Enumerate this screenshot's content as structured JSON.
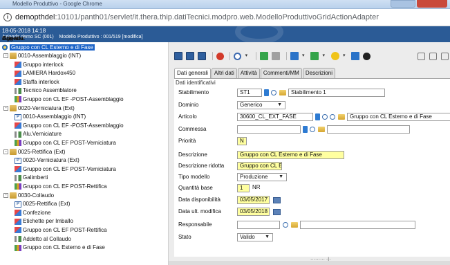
{
  "browser": {
    "title": "Modello Produttivo - Google Chrome",
    "url_host": "demopthdel",
    "url_path": ":10101/panth01/servlet/it.thera.thip.datiTecnici.modpro.web.ModelloProduttivoGridActionAdapter",
    "info_icon": "info-icon"
  },
  "header": {
    "timestamp": "18-05-2018  14:18",
    "azienda_label": "Azienda:",
    "azienda_value": "Azienda demo SC (001)",
    "oggetto_label": "Oggetto:",
    "oggetto_value": "Modello Produttivo : 001/519 [modifica]"
  },
  "tree": {
    "root": "Gruppo con CL Esterno e di Fase",
    "nodes": [
      {
        "text": "0010-Assemblaggio (INT)",
        "icon": "folder",
        "toggle": "-"
      },
      {
        "text": "Gruppo interlock",
        "icon": "cube"
      },
      {
        "text": "LAMIERA Hardox450",
        "icon": "cube"
      },
      {
        "text": "Staffa interlock",
        "icon": "cube"
      },
      {
        "text": "Tecnico Assemblatore",
        "icon": "tool"
      },
      {
        "text": "Gruppo con CL EF -POST-Assemblaggio",
        "icon": "link"
      },
      {
        "text": "0020-Verniciatura (Ext)",
        "icon": "folder",
        "toggle": "-"
      },
      {
        "text": "0010-Assemblaggio (INT)",
        "icon": "doc"
      },
      {
        "text": "Gruppo con CL EF -POST-Assemblaggio",
        "icon": "cube"
      },
      {
        "text": "Alu.Verniciature",
        "icon": "tool"
      },
      {
        "text": "Gruppo con CL EF POST-Verniciatura",
        "icon": "link"
      },
      {
        "text": "0025-Rettifica (Ext)",
        "icon": "folder",
        "toggle": "-"
      },
      {
        "text": "0020-Verniciatura (Ext)",
        "icon": "doc"
      },
      {
        "text": "Gruppo con CL EF POST-Verniciatura",
        "icon": "cube"
      },
      {
        "text": "Galimberti",
        "icon": "tool"
      },
      {
        "text": "Gruppo con CL EF POST-Rettifica",
        "icon": "link"
      },
      {
        "text": "0030-Collaudo",
        "icon": "folder",
        "toggle": "-"
      },
      {
        "text": "0025-Rettifica (Ext)",
        "icon": "doc"
      },
      {
        "text": "Confezione",
        "icon": "cube"
      },
      {
        "text": "Etichette per Imballo",
        "icon": "cube"
      },
      {
        "text": "Gruppo con CL EF POST-Rettifica",
        "icon": "cube"
      },
      {
        "text": "Addetto al Collaudo",
        "icon": "tool"
      },
      {
        "text": "Gruppo con CL Esterno e di Fase",
        "icon": "link"
      }
    ]
  },
  "tabs": [
    "Dati generali",
    "Altri dati",
    "Attività",
    "Commenti/MM",
    "Descrizioni"
  ],
  "form": {
    "section": "Dati identificativi",
    "stabilimento_label": "Stabilimento",
    "stabilimento_code": "ST1",
    "stabilimento_desc": "Stabilimento 1",
    "dominio_label": "Dominio",
    "dominio_value": "Generico",
    "articolo_label": "Articolo",
    "articolo_code": "30600_CL_EXT_FASE",
    "articolo_desc": "Gruppo con CL Esterno e di Fase",
    "commessa_label": "Commessa",
    "priorita_label": "Priorità",
    "priorita_value": "N",
    "descrizione_label": "Descrizione",
    "descrizione_value": "Gruppo con CL Esterno e di Fase",
    "descr_ridotta_label": "Descrizione ridotta",
    "descr_ridotta_value": "Gruppo con CL E",
    "tipo_modello_label": "Tipo modello",
    "tipo_modello_value": "Produzione",
    "quantita_label": "Quantità base",
    "quantita_value": "1",
    "quantita_um": "NR",
    "data_disp_label": "Data disponibilità",
    "data_disp_value": "03/05/2017",
    "data_mod_label": "Data ult. modifica",
    "data_mod_value": "03/05/2018",
    "responsabile_label": "Responsabile",
    "stato_label": "Stato",
    "stato_value": "Valido"
  },
  "colors": {
    "header_bg": "#2b5b96",
    "selected_bg": "#1c64c8",
    "required_field": "#ffffa0"
  }
}
